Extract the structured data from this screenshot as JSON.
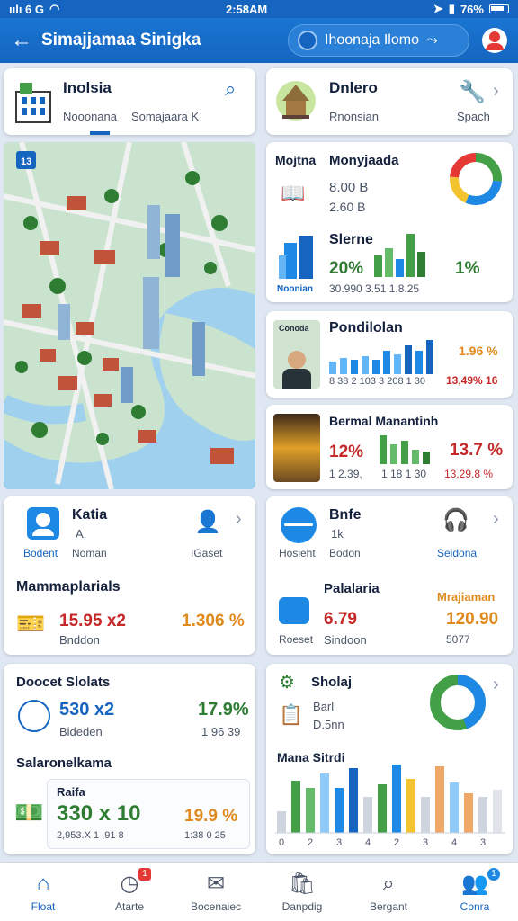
{
  "status": {
    "time": "2:58AM",
    "left_text": "ıılı 6 G",
    "battery": "76%"
  },
  "appbar": {
    "title": "Simajjamaa Sinigka",
    "pill_label": "Ihoonaja Ilomo"
  },
  "cards": {
    "indonesia": {
      "title": "Inolsia",
      "sub1": "Nooonana",
      "sub2": "Somajaara K"
    },
    "dniero": {
      "title": "Dnlero",
      "sub1": "Rnonsian",
      "sub2": "Spach"
    },
    "mojrta": {
      "title1": "Mojtna",
      "title2": "Monyjaada",
      "v1": "8.00 B",
      "v2": "2.60 B"
    },
    "slerne": {
      "title": "Slerne",
      "label": "Noonian",
      "pct_left": "20%",
      "pct_right": "1%",
      "axis": "30.990 3.51 1.8.25"
    },
    "pondilolan": {
      "title": "Pondilolan",
      "thumb_label": "Conoda",
      "value_orange": "1.96 %",
      "value_red": "13,49% 16",
      "axis": "8 38 2 103 3 208 1 30"
    },
    "bermal": {
      "title": "Bermal Manantinh",
      "pct_left": "12%",
      "sub_left": "1 2.39,",
      "axis_mid": "1 18 1 30",
      "pct_right": "13.7 %",
      "sub_right": "13,29.8 %"
    },
    "katia": {
      "title": "Katia",
      "sub1": "A,",
      "label": "Bodent",
      "label2": "Noman",
      "label3": "IGaset"
    },
    "bnfe": {
      "title": "Bnfe",
      "sub1": "1k",
      "label": "Hosieht",
      "label2": "Bodon",
      "label3": "Seidona"
    },
    "mammap": {
      "title": "Mammaplarials",
      "value_red": "15.95 x2",
      "value_orange": "1.306 %",
      "sub": "Bnddon"
    },
    "palalaria": {
      "title": "Palalaria",
      "label": "Roeset",
      "label2": "Sindoon",
      "value_red": "6.79",
      "title_right": "Mrajiaman",
      "value_right": "120.90",
      "sub_right": "5077"
    },
    "doocet": {
      "title": "Doocet Slolats",
      "value_blue": "530 x2",
      "sub": "Bideden",
      "value_green": "17.9%",
      "sub_right": "1 96 39"
    },
    "salaron": {
      "title": "Salaronelkama",
      "box_title": "Raifa",
      "value_green": "330 x 10",
      "sub_left": "2,953.X 1 ,91 8",
      "value_orange": "19.9 %",
      "sub_right": "1:38 0 25"
    },
    "sholaj": {
      "title": "Sholaj",
      "sub1": "Barl",
      "sub2": "D.5nn",
      "chart_title": "Mana Sitrdi"
    }
  },
  "nav": [
    {
      "label": "Float"
    },
    {
      "label": "Atarte",
      "badge": "1"
    },
    {
      "label": "Bocenaiec"
    },
    {
      "label": "Danpdig"
    },
    {
      "label": "Bergant"
    },
    {
      "label": "Conra",
      "badge": "1"
    }
  ],
  "colors": {
    "primary": "#1565c0",
    "accent_green": "#43a047",
    "accent_red": "#c62828",
    "accent_orange": "#f0a030"
  }
}
